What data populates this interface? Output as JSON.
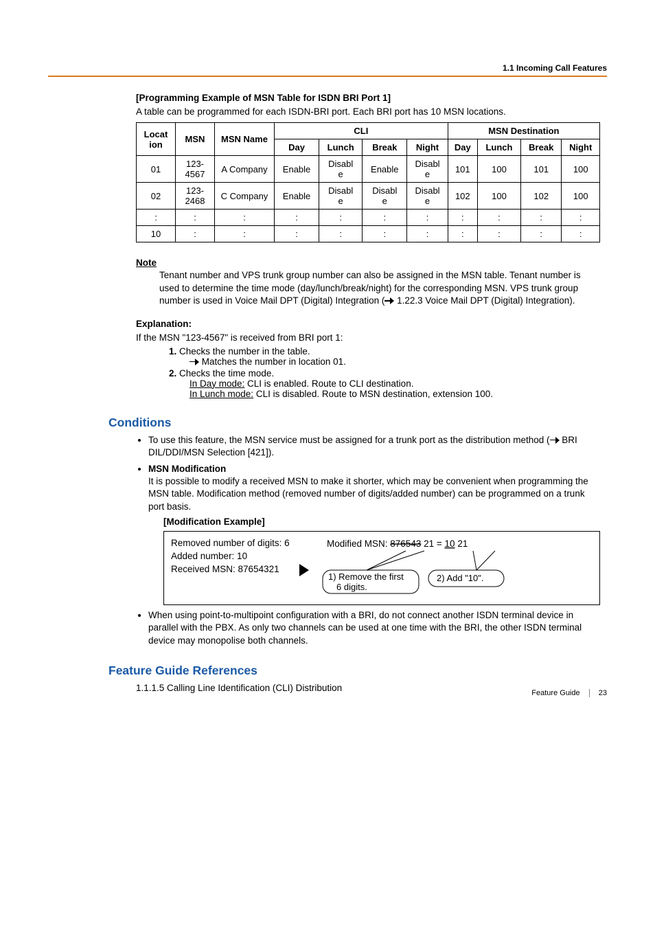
{
  "header": {
    "section": "1.1 Incoming Call Features"
  },
  "intro": {
    "title": "[Programming Example of MSN Table for ISDN BRI Port 1]",
    "desc": "A table can be programmed for each ISDN-BRI port. Each BRI port has 10 MSN locations."
  },
  "table": {
    "headers": {
      "location": "Location",
      "msn": "MSN",
      "msn_name": "MSN Name",
      "cli_group": "CLI",
      "dest_group": "MSN Destination",
      "day": "Day",
      "lunch": "Lunch",
      "break": "Break",
      "night": "Night"
    },
    "rows": [
      {
        "loc": "01",
        "msn": "123-4567",
        "name": "A Company",
        "cli": [
          "Enable",
          "Disable",
          "Enable",
          "Disable"
        ],
        "dest": [
          "101",
          "100",
          "101",
          "100"
        ]
      },
      {
        "loc": "02",
        "msn": "123-2468",
        "name": "C Company",
        "cli": [
          "Enable",
          "Disable",
          "Disable",
          "Disable"
        ],
        "dest": [
          "102",
          "100",
          "102",
          "100"
        ]
      },
      {
        "loc": ":",
        "msn": ":",
        "name": ":",
        "cli": [
          ":",
          ":",
          ":",
          ":"
        ],
        "dest": [
          ":",
          ":",
          ":",
          ":"
        ]
      },
      {
        "loc": "10",
        "msn": ":",
        "name": ":",
        "cli": [
          ":",
          ":",
          ":",
          ":"
        ],
        "dest": [
          ":",
          ":",
          ":",
          ":"
        ]
      }
    ]
  },
  "note": {
    "label": "Note",
    "body": "Tenant number and VPS trunk group number can also be assigned in the MSN table. Tenant number is used to determine the time mode (day/lunch/break/night) for the corresponding MSN. VPS trunk group number is used in Voice Mail DPT (Digital) Integration (",
    "ref": " 1.22.3 Voice Mail DPT (Digital) Integration).",
    "arrow": ""
  },
  "explanation": {
    "title": "Explanation:",
    "lead": "If the MSN \"123-4567\" is received from BRI port 1:",
    "step1": "Checks the number in the table.",
    "step1sub": " Matches the number in location 01.",
    "step2": "Checks the time mode.",
    "step2a_label": "In Day mode:",
    "step2a_text": " CLI is enabled. Route to CLI destination.",
    "step2b_label": "In Lunch mode:",
    "step2b_text": " CLI is disabled. Route to MSN destination, extension 100."
  },
  "conditions": {
    "title": "Conditions",
    "b1a": "To use this feature, the MSN service must be assigned for a trunk port as the distribution method (",
    "b1b": " BRI DIL/DDI/MSN Selection [421]).",
    "b2_title": "MSN Modification",
    "b2_body": "It is possible to modify a received MSN to make it shorter, which may be convenient when programming the MSN table. Modification method (removed number of digits/added number) can be programmed on a trunk port basis.",
    "mod_title": "[Modification Example]",
    "mod_left_l1": "Removed number of digits: 6",
    "mod_left_l2": "Added number: 10",
    "mod_left_l3": "Received MSN: 87654321",
    "mod_right_lead": "Modified MSN:  ",
    "mod_right_strike": "876543",
    "mod_right_mid": "  21 = ",
    "mod_right_res_u": "10",
    "mod_right_res": "21",
    "callout1": "1) Remove the first 6 digits.",
    "callout2": "2) Add \"10\".",
    "b3": "When using point-to-multipoint configuration with a BRI, do not connect another ISDN terminal device in parallel with the PBX. As only two channels can be used at one time with the BRI, the other ISDN terminal device may monopolise both channels."
  },
  "refs": {
    "title": "Feature Guide References",
    "item": "1.1.1.5 Calling Line Identification (CLI) Distribution"
  },
  "footer": {
    "label": "Feature Guide",
    "page": "23"
  },
  "chart_data": {
    "type": "table",
    "title": "Programming Example of MSN Table for ISDN BRI Port 1",
    "columns": [
      "Location",
      "MSN",
      "MSN Name",
      "CLI Day",
      "CLI Lunch",
      "CLI Break",
      "CLI Night",
      "Dest Day",
      "Dest Lunch",
      "Dest Break",
      "Dest Night"
    ],
    "rows": [
      [
        "01",
        "123-4567",
        "A Company",
        "Enable",
        "Disable",
        "Enable",
        "Disable",
        101,
        100,
        101,
        100
      ],
      [
        "02",
        "123-2468",
        "C Company",
        "Enable",
        "Disable",
        "Disable",
        "Disable",
        102,
        100,
        102,
        100
      ]
    ],
    "row_count_total": 10
  }
}
